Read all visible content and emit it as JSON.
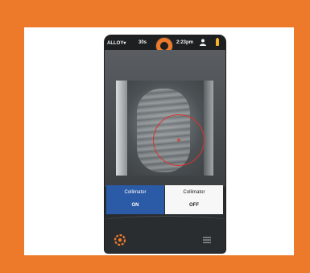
{
  "status_bar": {
    "alloy_label": "ALLOY▾",
    "duration": "30s",
    "time": "2:23pm"
  },
  "collimator_toggle": {
    "on_option": {
      "label": "Collimator",
      "state": "ON"
    },
    "off_option": {
      "label": "Collimator",
      "state": "OFF"
    },
    "selected": "ON"
  },
  "icons": {
    "trigger": "orange-ring-icon",
    "user": "user-icon",
    "battery": "battery-icon",
    "menu": "settings-icon",
    "list": "list-icon"
  },
  "colors": {
    "frame_orange": "#ec7a2a",
    "toggle_on_blue": "#2b5aa6",
    "collimator_red": "#d9342b",
    "battery_yellow": "#f0b429"
  }
}
